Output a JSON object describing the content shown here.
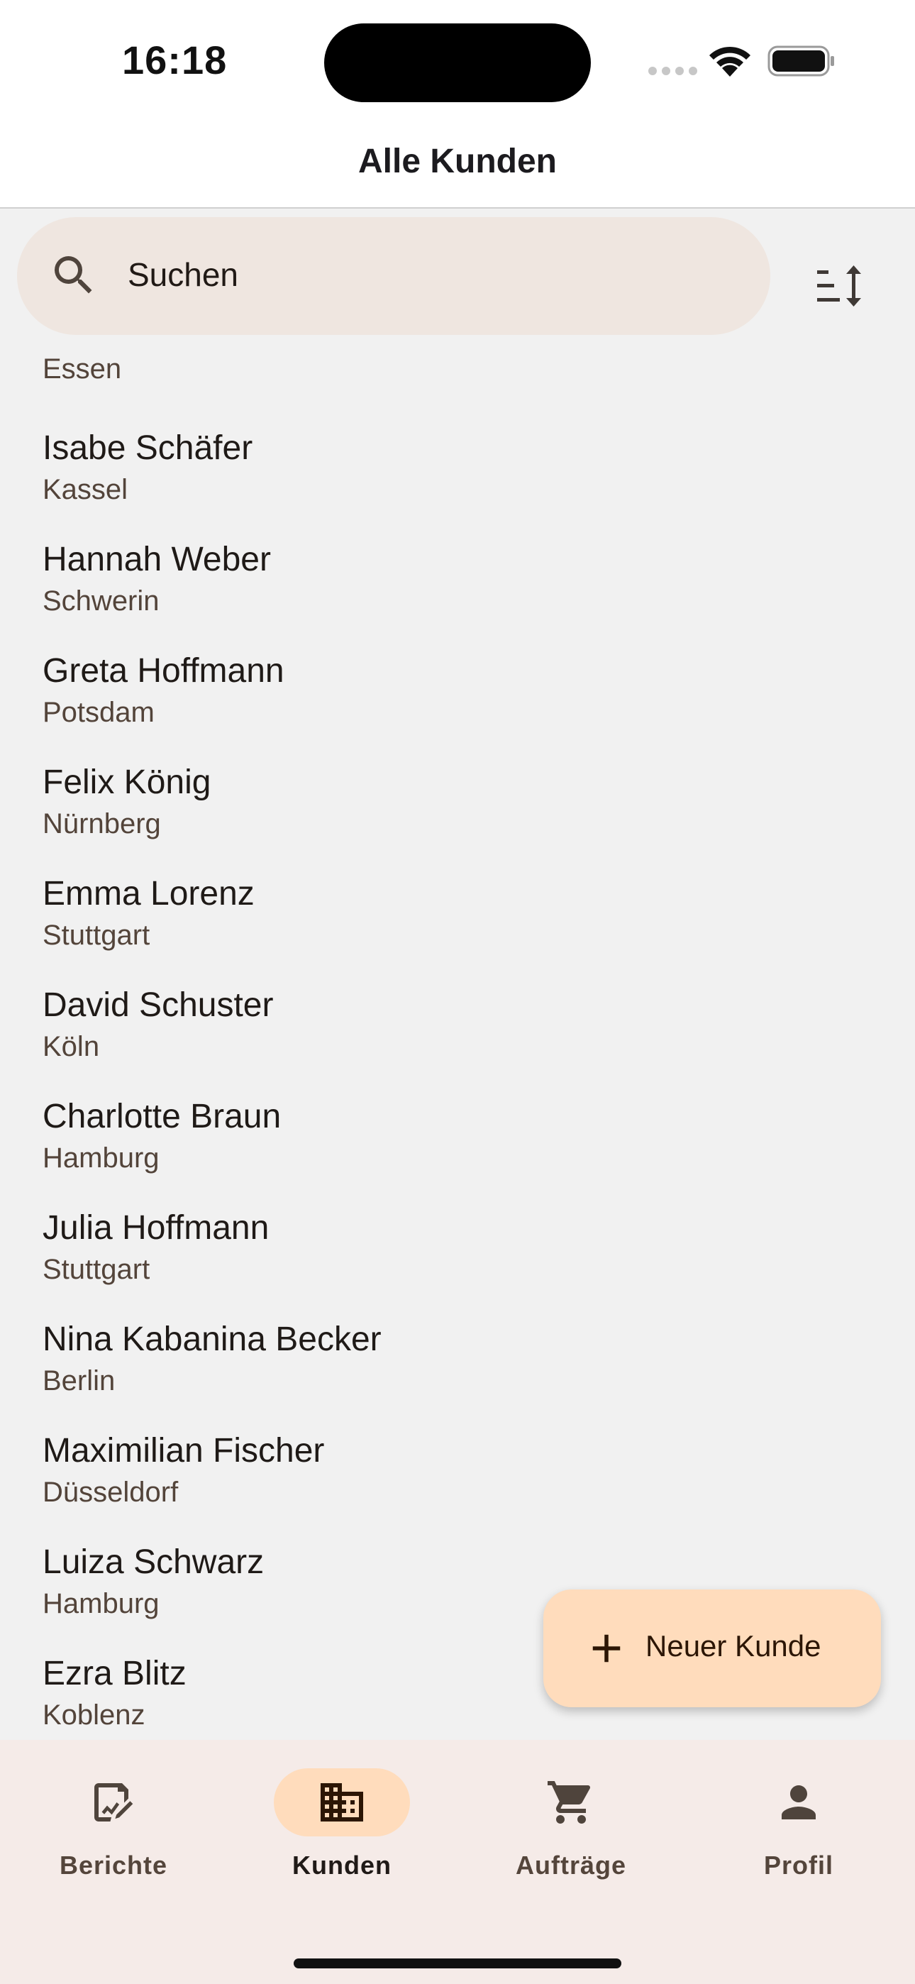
{
  "status_bar": {
    "time": "16:18"
  },
  "header": {
    "title": "Alle Kunden"
  },
  "search": {
    "placeholder": "Suchen"
  },
  "list": {
    "partial_top_city": "Essen",
    "customers": [
      {
        "name": "Isabe Schäfer",
        "city": "Kassel"
      },
      {
        "name": "Hannah Weber",
        "city": "Schwerin"
      },
      {
        "name": "Greta Hoffmann",
        "city": "Potsdam"
      },
      {
        "name": "Felix König",
        "city": "Nürnberg"
      },
      {
        "name": "Emma Lorenz",
        "city": "Stuttgart"
      },
      {
        "name": "David Schuster",
        "city": "Köln"
      },
      {
        "name": "Charlotte Braun",
        "city": "Hamburg"
      },
      {
        "name": "Julia Hoffmann",
        "city": "Stuttgart"
      },
      {
        "name": "Nina Kabanina Becker",
        "city": "Berlin"
      },
      {
        "name": "Maximilian Fischer",
        "city": "Düsseldorf"
      },
      {
        "name": "Luiza Schwarz",
        "city": "Hamburg"
      },
      {
        "name": "Ezra Blitz",
        "city": "Koblenz"
      }
    ]
  },
  "fab": {
    "label": "Neuer Kunde",
    "icon": "plus-icon"
  },
  "bottom_nav": {
    "items": [
      {
        "label": "Berichte",
        "icon": "report-edit-icon",
        "active": false
      },
      {
        "label": "Kunden",
        "icon": "building-icon",
        "active": true
      },
      {
        "label": "Aufträge",
        "icon": "cart-icon",
        "active": false
      },
      {
        "label": "Profil",
        "icon": "person-icon",
        "active": false
      }
    ]
  },
  "colors": {
    "accent_container": "#ffdcbc",
    "search_background": "#efe6e0",
    "bottom_nav_background": "#f5ebe8",
    "list_background": "#f1f1f1"
  }
}
